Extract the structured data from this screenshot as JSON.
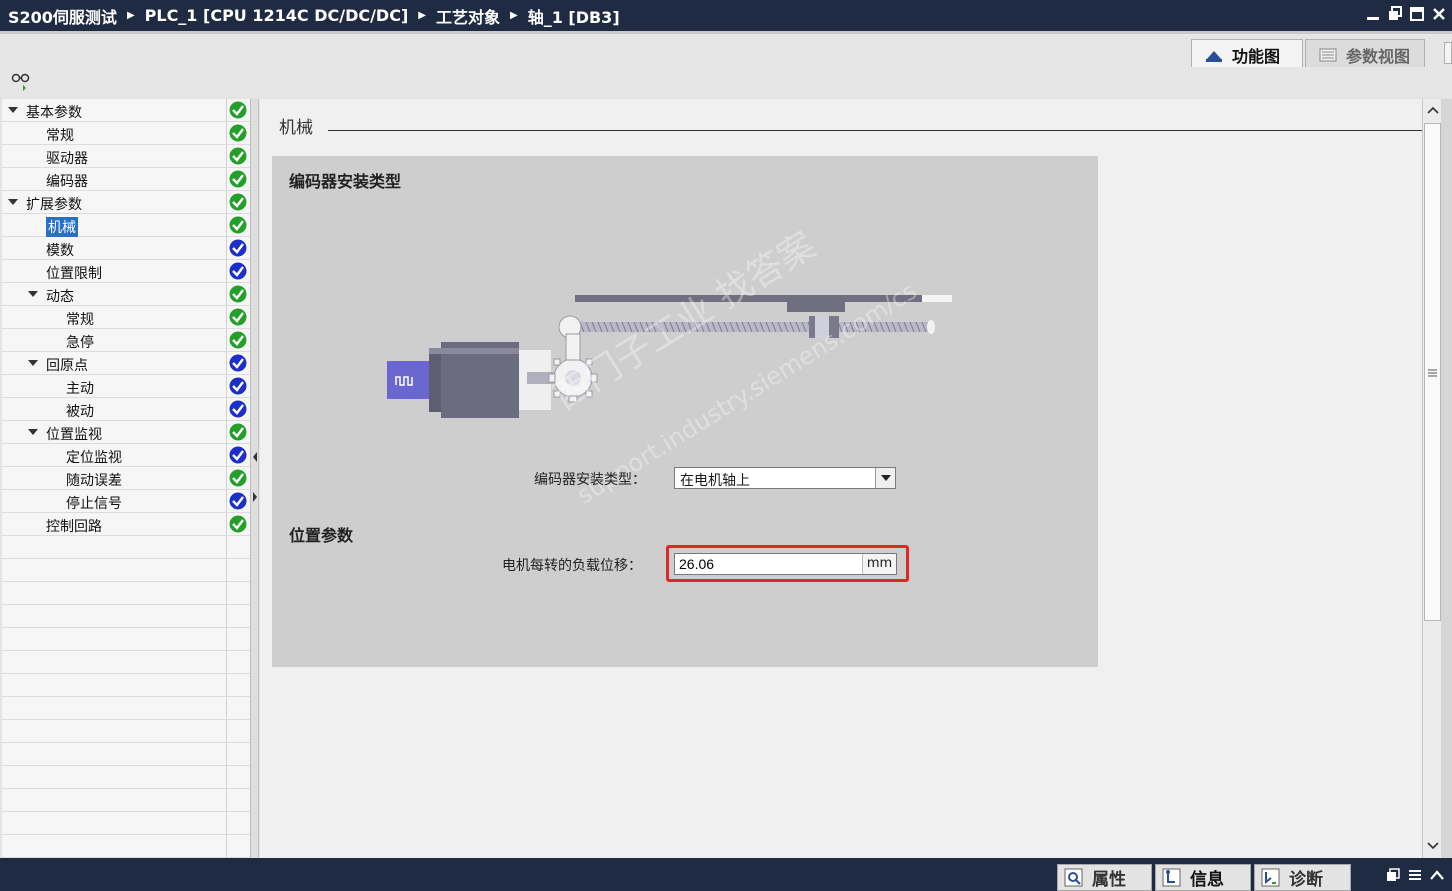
{
  "title_bar": {
    "breadcrumbs": [
      "S200伺服测试",
      "PLC_1 [CPU 1214C DC/DC/DC]",
      "工艺对象",
      "轴_1 [DB3]"
    ]
  },
  "view_tabs": [
    {
      "label": "功能图",
      "active": true,
      "icon": "function-view-icon"
    },
    {
      "label": "参数视图",
      "active": false,
      "icon": "parameter-view-icon"
    }
  ],
  "nav_tree": [
    {
      "label": "基本参数",
      "level": 0,
      "expanded": true,
      "status": "ok-green"
    },
    {
      "label": "常规",
      "level": 1,
      "status": "ok-green"
    },
    {
      "label": "驱动器",
      "level": 1,
      "status": "ok-green"
    },
    {
      "label": "编码器",
      "level": 1,
      "status": "ok-green"
    },
    {
      "label": "扩展参数",
      "level": 0,
      "expanded": true,
      "status": "ok-green"
    },
    {
      "label": "机械",
      "level": 1,
      "selected": true,
      "status": "ok-green"
    },
    {
      "label": "模数",
      "level": 1,
      "status": "ok-blue"
    },
    {
      "label": "位置限制",
      "level": 1,
      "status": "ok-blue"
    },
    {
      "label": "动态",
      "level": 1,
      "expanded": true,
      "status": "ok-green"
    },
    {
      "label": "常规",
      "level": 2,
      "status": "ok-green"
    },
    {
      "label": "急停",
      "level": 2,
      "status": "ok-green"
    },
    {
      "label": "回原点",
      "level": 1,
      "expanded": true,
      "status": "ok-blue"
    },
    {
      "label": "主动",
      "level": 2,
      "status": "ok-blue"
    },
    {
      "label": "被动",
      "level": 2,
      "status": "ok-blue"
    },
    {
      "label": "位置监视",
      "level": 1,
      "expanded": true,
      "status": "ok-green"
    },
    {
      "label": "定位监视",
      "level": 2,
      "status": "ok-blue"
    },
    {
      "label": "随动误差",
      "level": 2,
      "status": "ok-green"
    },
    {
      "label": "停止信号",
      "level": 2,
      "status": "ok-blue"
    },
    {
      "label": "控制回路",
      "level": 1,
      "status": "ok-green"
    }
  ],
  "content": {
    "section_title": "机械",
    "encoder_heading": "编码器安装类型",
    "encoder_field_label": "编码器安装类型：",
    "encoder_value": "在电机轴上",
    "position_heading": "位置参数",
    "load_label": "电机每转的负载位移：",
    "load_value": "26.06",
    "load_unit": "mm",
    "watermark_text": "西门子工业  找答案",
    "watermark_url": "support.industry.siemens.com/cs"
  },
  "bottom_tabs": [
    {
      "label": "属性",
      "icon": "properties-icon"
    },
    {
      "label": "信息",
      "icon": "info-icon"
    },
    {
      "label": "诊断",
      "icon": "diagnostics-icon"
    }
  ],
  "colors": {
    "titlebar": "#1e2b42",
    "status_green": "#22a02a",
    "status_blue": "#1c2fc8",
    "highlight": "#e3261f",
    "selection": "#2a6fc7"
  }
}
